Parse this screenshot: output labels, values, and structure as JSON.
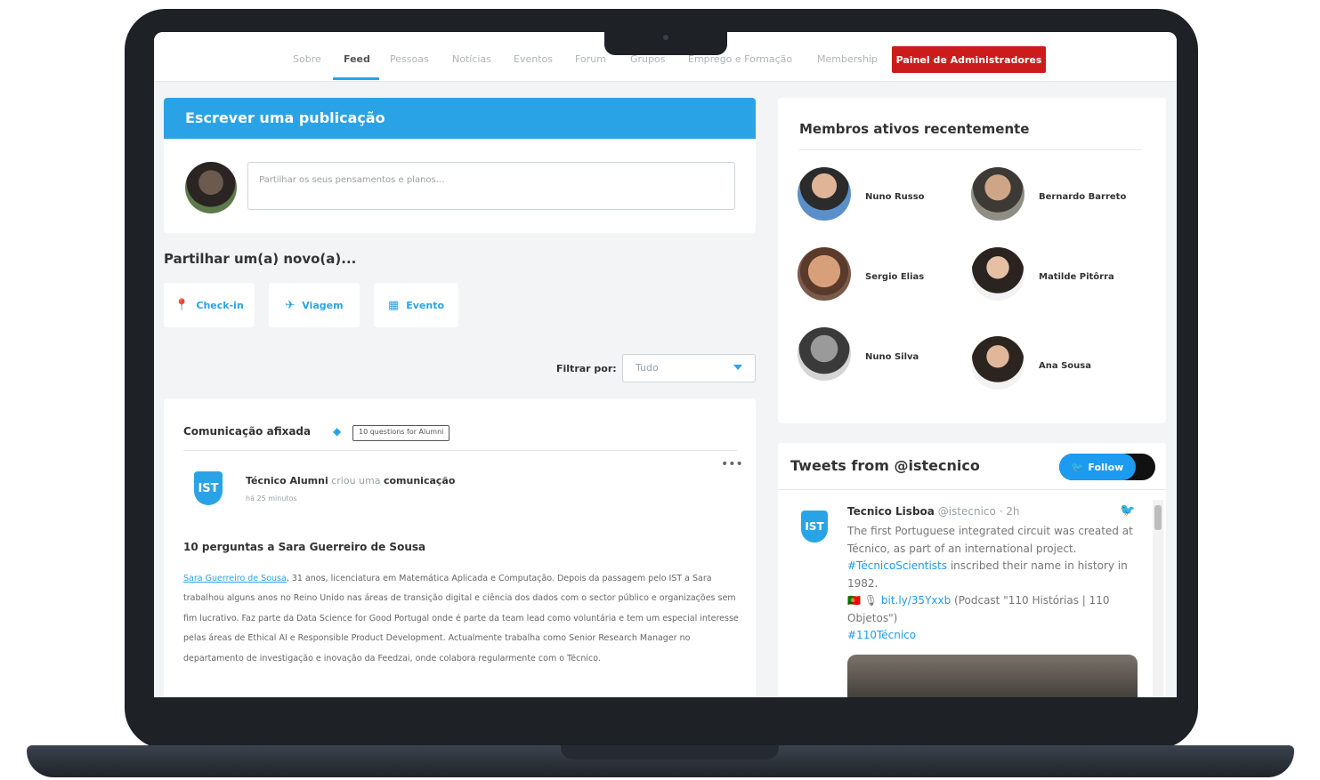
{
  "nav": {
    "items": [
      "Sobre",
      "Feed",
      "Pessoas",
      "Notícias",
      "Eventos",
      "Forum",
      "Grupos",
      "Emprego e Formação",
      "Membership"
    ],
    "active": "Feed",
    "admin_button": "Painel de Administradores"
  },
  "post_box": {
    "title": "Escrever uma publicação",
    "placeholder": "Partilhar os seus pensamentos e planos..."
  },
  "share": {
    "title": "Partilhar um(a) novo(a)...",
    "buttons": [
      {
        "label": "Check-in",
        "icon": "map-pin-icon"
      },
      {
        "label": "Viagem",
        "icon": "plane-icon"
      },
      {
        "label": "Evento",
        "icon": "calendar-icon"
      }
    ]
  },
  "filter": {
    "label": "Filtrar por:",
    "selected": "Tudo"
  },
  "feed": {
    "pinned_label": "Comunicação afixada",
    "pinned_tag": "10 questions for Alumni",
    "post": {
      "author": "Técnico Alumni",
      "action_prefix": "criou uma",
      "action_object": "comunicação",
      "time": "há 25 minutos",
      "title": "10 perguntas a Sara Guerreiro de Sousa",
      "body_link": "Sara Guerreiro de Sousa",
      "body_text": ", 31 anos, licenciatura em Matemática Aplicada e Computação. Depois da passagem pelo IST a Sara trabalhou alguns anos no Reino Unido nas áreas de transição digital e ciência dos dados com o sector público e organizações sem fim lucrativo. Faz parte da Data Science for Good Portugal onde é parte da team lead como voluntária e tem um especial interesse pelas áreas de Ethical AI e Responsible Product Development. Actualmente trabalha como Senior Research Manager no departamento de investigação e inovação da Feedzai, onde colabora regularmente com o Técnico."
    }
  },
  "members": {
    "title": "Membros ativos recentemente",
    "list": [
      "Nuno Russo",
      "Bernardo Barreto",
      "Sergio Elias",
      "Matilde Pitôrra",
      "Nuno Silva",
      "Ana Sousa"
    ]
  },
  "tweets": {
    "title": "Tweets from @istecnico",
    "follow_label": "Follow",
    "tweet": {
      "author": "Tecnico Lisboa",
      "handle_time": "@istecnico · 2h",
      "line1": "The first Portuguese integrated circuit was created at Técnico, as part of an international project. ",
      "hashtag1": "#TécnicoScientists",
      "line2": " inscribed their name in history in 1982.",
      "link": "bit.ly/35Yxxb",
      "line3": " (Podcast \"110 Histórias | 110 Objetos\")",
      "hashtag2": "#110Técnico"
    }
  },
  "colors": {
    "accent": "#2aa3e6",
    "admin": "#cc1b1b",
    "twitter": "#1d9bf0"
  }
}
